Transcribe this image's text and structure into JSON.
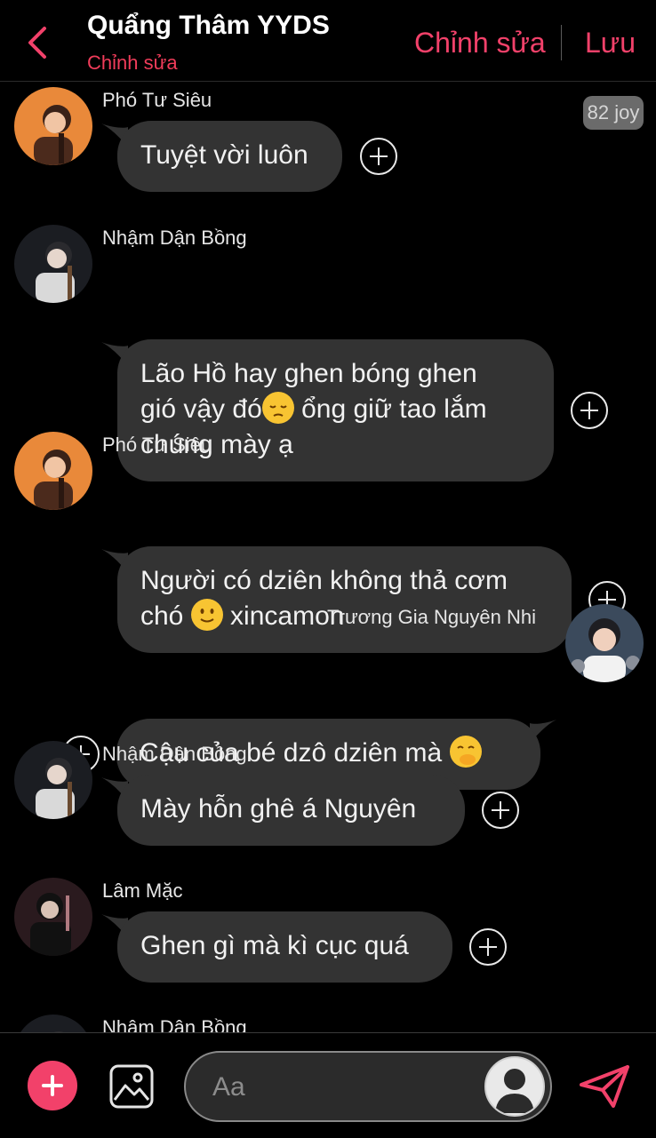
{
  "header": {
    "title": "Quẩng Thâm YYDS",
    "subtitle": "Chỉnh sửa",
    "edit_label": "Chỉnh sửa",
    "save_label": "Lưu",
    "accent": "#f2416a"
  },
  "messages": [
    {
      "sender": "Phó Tư Siêu",
      "lines": [
        "Tuyệt vời luôn"
      ],
      "side": "left"
    },
    {
      "sender": "Nhậm Dận Bồng",
      "lines": [
        "Lão Hồ hay ghen bóng ghen",
        "gió vậy đó",
        " ổng giữ tao lắm",
        "chúng mày ạ"
      ],
      "side": "left",
      "emoji": "pensive"
    },
    {
      "sender": "Phó Tư Siêu",
      "lines": [
        "Người có dziên không thả cơm",
        "chó ",
        " xincamon"
      ],
      "side": "left",
      "emoji": "slight-smile"
    },
    {
      "sender": "Trương Gia Nguyên Nhi",
      "lines": [
        "Cậu của bé dzô dziên mà "
      ],
      "side": "right",
      "emoji": "hand-over-mouth"
    },
    {
      "sender": "Nhậm Dận Bồng",
      "lines": [
        "Mày hỗn ghê á Nguyên"
      ],
      "side": "left"
    },
    {
      "sender": "Lâm Mặc",
      "lines": [
        "Ghen gì mà kì cục quá"
      ],
      "side": "left"
    },
    {
      "sender": "Nhậm Dận Bồng",
      "lines": [],
      "side": "left"
    }
  ],
  "badge": {
    "text": "82 joy"
  },
  "composer": {
    "placeholder": "Aa",
    "icons": [
      "plus-icon",
      "image-icon",
      "avatar-icon",
      "send-icon"
    ]
  }
}
